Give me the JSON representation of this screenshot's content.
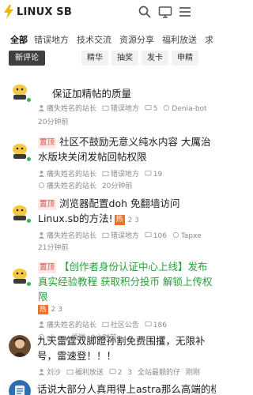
{
  "header": {
    "site_name": "LINUX SB",
    "icons": [
      "search-icon",
      "monitor-icon",
      "menu-icon"
    ]
  },
  "tabs": [
    {
      "label": "全部",
      "active": true
    },
    {
      "label": "错误地方",
      "active": false
    },
    {
      "label": "技术交流",
      "active": false
    },
    {
      "label": "资源分享",
      "active": false
    },
    {
      "label": "福利放送",
      "active": false
    },
    {
      "label": "求",
      "active": false
    }
  ],
  "subtabs": [
    {
      "label": "新评论",
      "active": true
    },
    {
      "label": "精华",
      "active": false
    },
    {
      "label": "抽奖",
      "active": false
    },
    {
      "label": "发卡",
      "active": false
    },
    {
      "label": "申精",
      "active": false
    }
  ],
  "topics": [
    {
      "title": "保证加精帖的质量",
      "pinned": false,
      "meta": {
        "author": "痛失姓名的站长",
        "category": "错误地方",
        "replies": "5",
        "last": "Denia-bot"
      },
      "time": "20分钟前"
    },
    {
      "title": "社区不鼓励无意义纯水内容 大厲治水版块关闭发帖回帖权限",
      "pin_label": "置顶",
      "pinned": true,
      "meta": {
        "author": "痛失姓名的站长",
        "category": "错误地方",
        "replies": "19",
        "last": "痛失姓名的站长",
        "time": "20分钟前"
      }
    },
    {
      "title": "浏览器配置doh 免翻墙访问Linux.sb的方法!",
      "pin_label": "置顶",
      "hot_label": "热",
      "extra": "2 3",
      "pinned": true,
      "meta": {
        "author": "痛失姓名的站长",
        "category": "错误地方",
        "replies": "106",
        "last": "Tapxe"
      },
      "time": "21分钟前"
    },
    {
      "title": "【创作者身份认证中心上线】发布真实经验教程 获取积分投币 解锁上传权限",
      "pin_label": "置顶",
      "hot_label": "热",
      "extra": "2 3",
      "pinned": true,
      "meta": {
        "author": "痛失姓名的站长",
        "category": "社区公告",
        "replies": "186"
      },
      "meta2": {
        "last": "oh my 烦饼",
        "time": "9小时前"
      }
    },
    {
      "title": "九天雷霆双脚蹬孙割免费围攫，无限补号，雷速登！！！",
      "pinned": false,
      "meta": {
        "author": "刘沙",
        "category": "福利放送",
        "replies": "2",
        "extra": "3",
        "last": "全站最靓的仔",
        "time": "刚刚"
      }
    },
    {
      "title": "话说大部分人真用得上astra那么高端的楼",
      "pinned": false
    }
  ],
  "colors": {
    "accent_green": "#2a9d3b",
    "pin_red": "#e0483e",
    "hot_orange": "#e8742c",
    "chip_active": "#3f3f3f"
  }
}
